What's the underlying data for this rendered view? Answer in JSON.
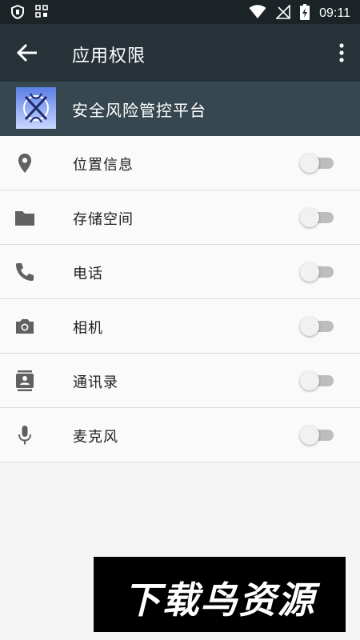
{
  "status_bar": {
    "time": "09:11",
    "icons": [
      "shield-icon",
      "grid-icon",
      "wifi-icon",
      "no-signal-icon",
      "battery-charging-icon"
    ]
  },
  "app_bar": {
    "title": "应用权限",
    "back_icon": "arrow-left-icon",
    "menu_icon": "more-vert-icon"
  },
  "app_header": {
    "app_name": "安全风险管控平台",
    "icon": "app-logo-icon"
  },
  "permissions": [
    {
      "label": "位置信息",
      "icon": "location-icon",
      "enabled": false
    },
    {
      "label": "存储空间",
      "icon": "folder-icon",
      "enabled": false
    },
    {
      "label": "电话",
      "icon": "phone-icon",
      "enabled": false
    },
    {
      "label": "相机",
      "icon": "camera-icon",
      "enabled": false
    },
    {
      "label": "通讯录",
      "icon": "contacts-icon",
      "enabled": false
    },
    {
      "label": "麦克风",
      "icon": "microphone-icon",
      "enabled": false
    }
  ],
  "watermark": {
    "text": "下载鸟资源"
  },
  "colors": {
    "status_bar": "#1b2327",
    "app_bar": "#263238",
    "app_header": "#37474f",
    "icon_gray": "#616161",
    "toggle_track": "#bdbdbd"
  }
}
